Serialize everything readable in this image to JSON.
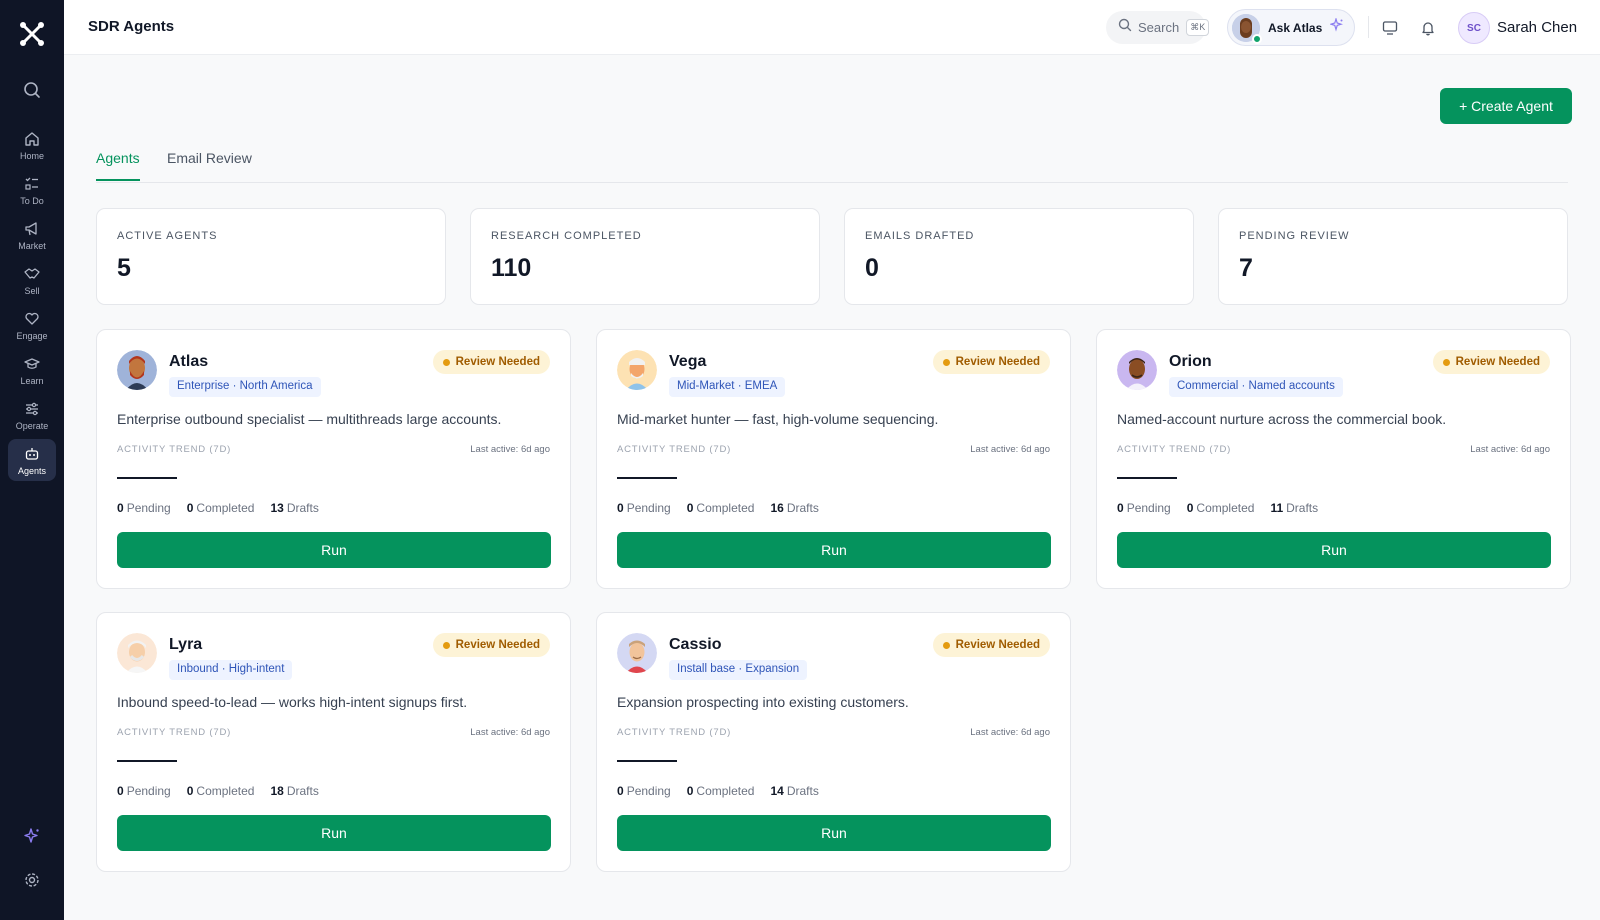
{
  "colors": {
    "brand": "#05935d",
    "sidebar": "#0f1526",
    "badge_bg": "#fdf3d6",
    "badge_dot": "#e49b0f"
  },
  "sidebar": {
    "logo_icon": "x-logo-icon",
    "items": [
      {
        "label": "Home",
        "icon": "home-icon"
      },
      {
        "label": "To Do",
        "icon": "checklist-icon"
      },
      {
        "label": "Market",
        "icon": "megaphone-icon"
      },
      {
        "label": "Sell",
        "icon": "handshake-icon"
      },
      {
        "label": "Engage",
        "icon": "heart-hand-icon"
      },
      {
        "label": "Learn",
        "icon": "graduation-cap-icon"
      },
      {
        "label": "Operate",
        "icon": "sliders-icon"
      },
      {
        "label": "Agents",
        "icon": "robot-icon",
        "active": true
      }
    ]
  },
  "header": {
    "title": "SDR Agents",
    "search_label": "Search",
    "search_shortcut": "⌘K",
    "ask_label": "Ask Atlas",
    "user_initials": "SC",
    "user_name": "Sarah Chen"
  },
  "main": {
    "create_label": "+ Create Agent",
    "tabs": [
      {
        "label": "Agents",
        "active": true
      },
      {
        "label": "Email Review",
        "active": false
      }
    ],
    "stats": [
      {
        "label": "ACTIVE AGENTS",
        "value": "5"
      },
      {
        "label": "RESEARCH COMPLETED",
        "value": "110"
      },
      {
        "label": "EMAILS DRAFTED",
        "value": "0"
      },
      {
        "label": "PENDING REVIEW",
        "value": "7"
      }
    ],
    "trend_label": "ACTIVITY TREND (7D)",
    "run_label": "Run",
    "badge_label": "Review Needed",
    "pending_label": "Pending",
    "completed_label": "Completed",
    "drafts_label": "Drafts",
    "agents": [
      {
        "name": "Atlas",
        "tag": "Enterprise · North America",
        "description": "Enterprise outbound specialist — multithreads large accounts.",
        "last_active": "Last active: 6d ago",
        "pending": "0",
        "completed": "0",
        "drafts": "13"
      },
      {
        "name": "Vega",
        "tag": "Mid-Market · EMEA",
        "description": "Mid-market hunter — fast, high-volume sequencing.",
        "last_active": "Last active: 6d ago",
        "pending": "0",
        "completed": "0",
        "drafts": "16"
      },
      {
        "name": "Orion",
        "tag": "Commercial · Named accounts",
        "description": "Named-account nurture across the commercial book.",
        "last_active": "Last active: 6d ago",
        "pending": "0",
        "completed": "0",
        "drafts": "11"
      },
      {
        "name": "Lyra",
        "tag": "Inbound · High-intent",
        "description": "Inbound speed-to-lead — works high-intent signups first.",
        "last_active": "Last active: 6d ago",
        "pending": "0",
        "completed": "0",
        "drafts": "18"
      },
      {
        "name": "Cassio",
        "tag": "Install base · Expansion",
        "description": "Expansion prospecting into existing customers.",
        "last_active": "Last active: 6d ago",
        "pending": "0",
        "completed": "0",
        "drafts": "14"
      }
    ]
  }
}
